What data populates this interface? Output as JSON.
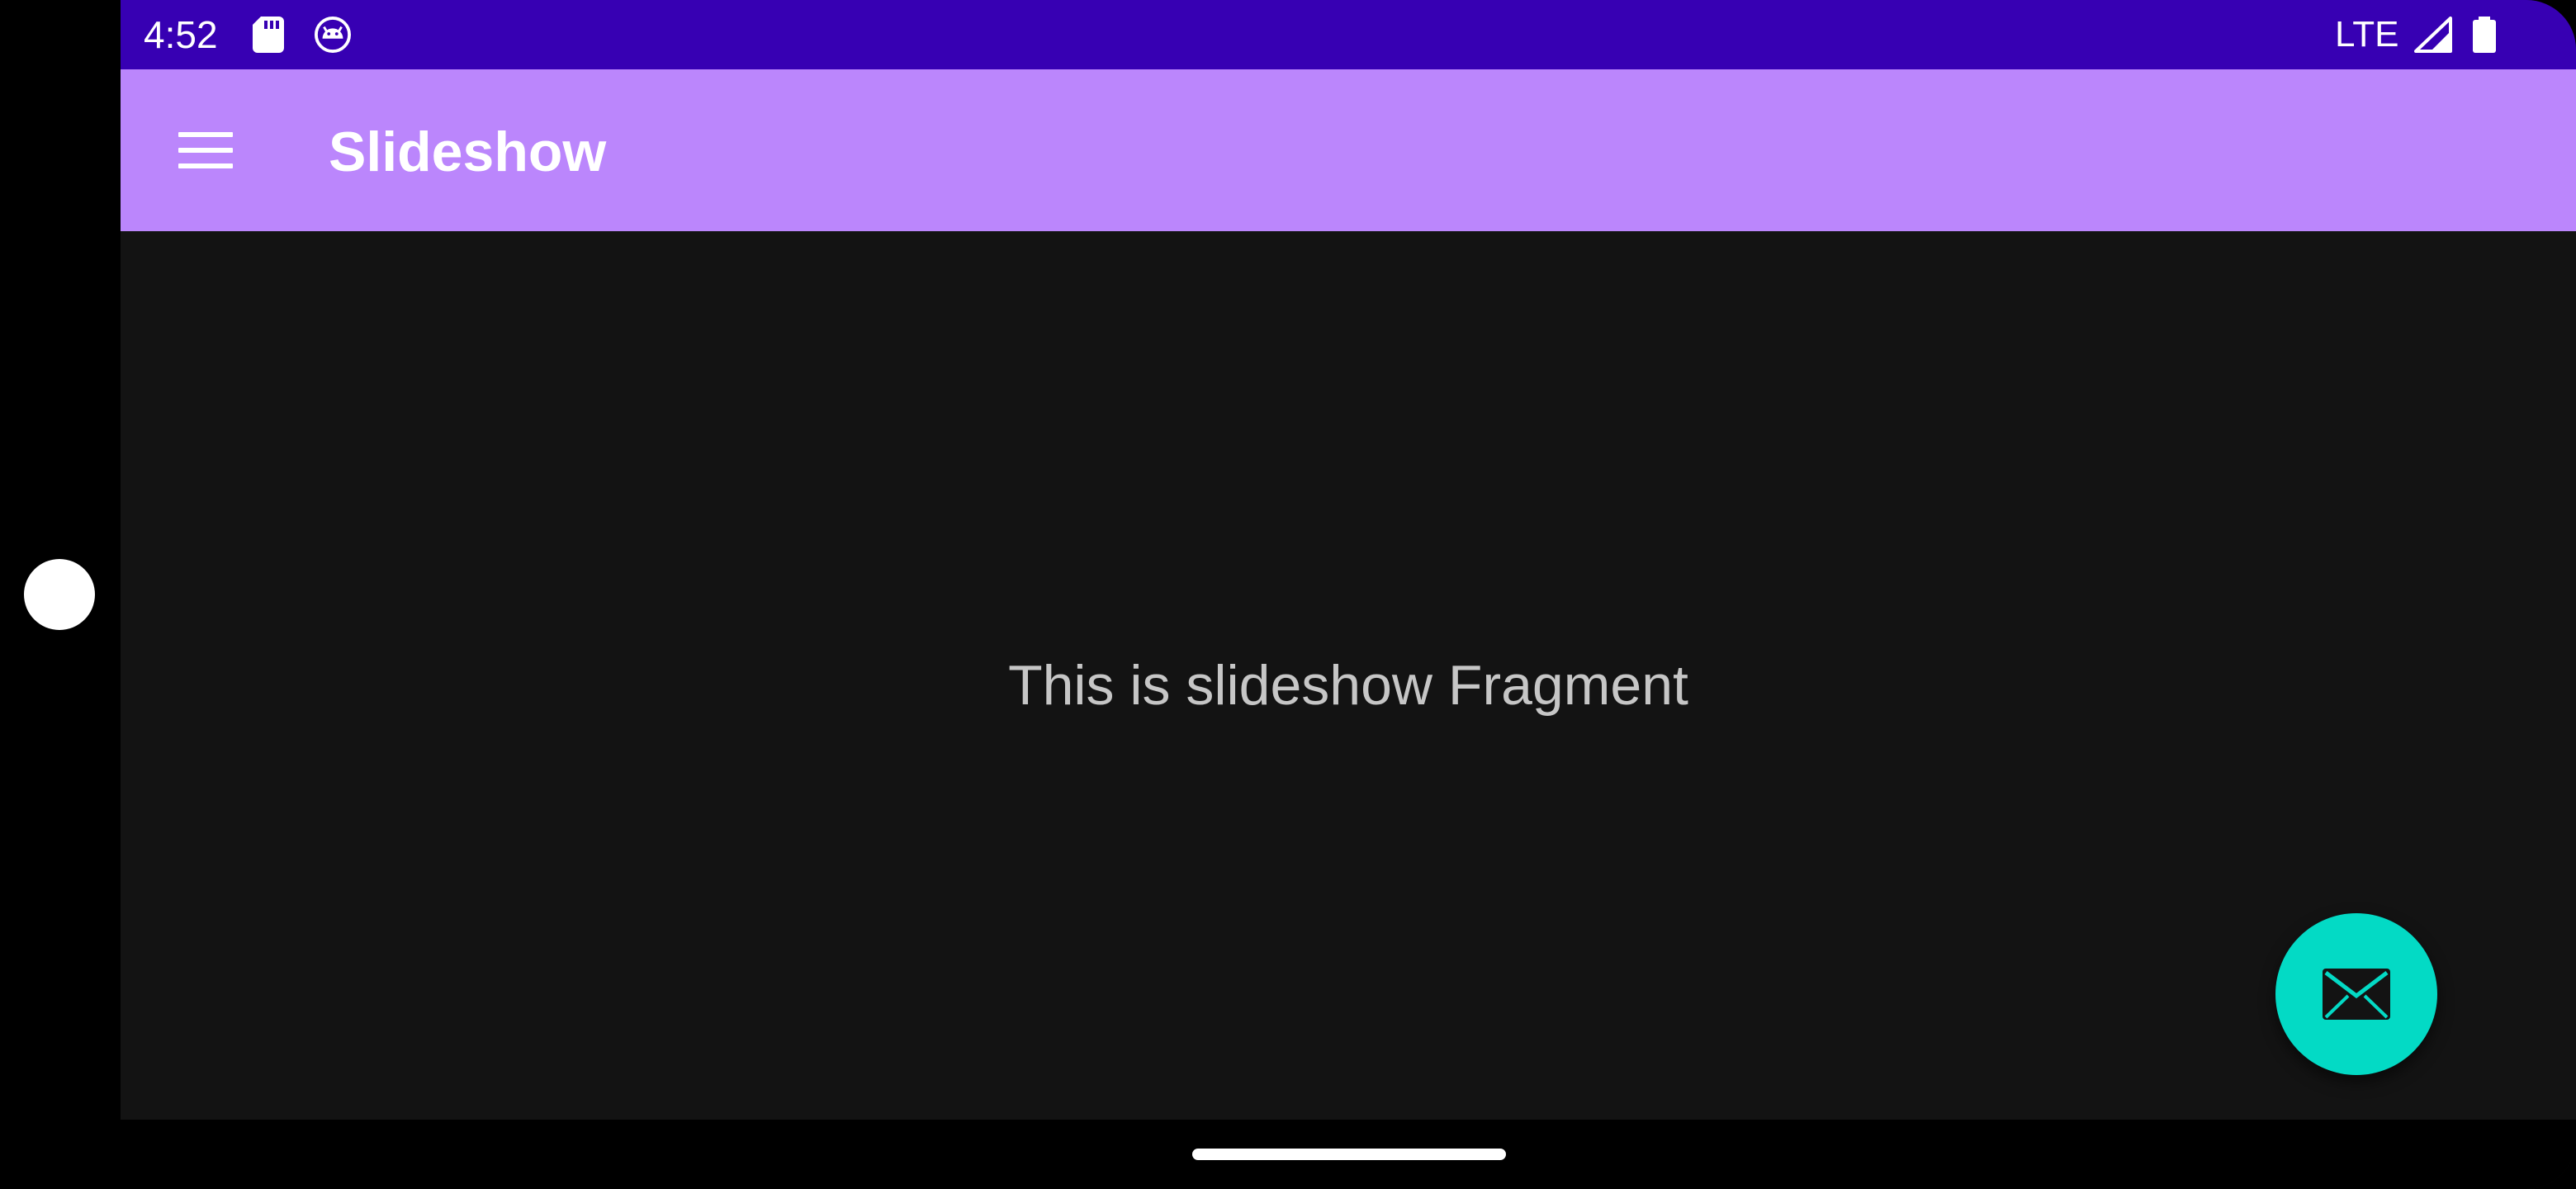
{
  "status_bar": {
    "time": "4:52",
    "network": "LTE",
    "left_icons": [
      "sd-card-icon",
      "android-debug-icon"
    ],
    "right_icons": [
      "signal-icon",
      "battery-icon"
    ],
    "color": "#3700b3"
  },
  "app_bar": {
    "title": "Slideshow",
    "nav_icon": "menu-icon",
    "color": "#bb86fc"
  },
  "content": {
    "text": "This is slideshow Fragment",
    "background": "#131313"
  },
  "fab": {
    "icon": "email-icon",
    "color": "#03dac5"
  },
  "navigation": {
    "gesture": "home-handle"
  }
}
